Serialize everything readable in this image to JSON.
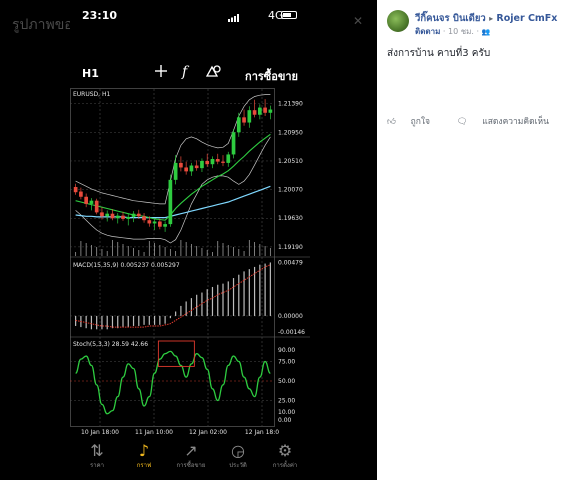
{
  "photo_bg_title": "รูปภาพของ วีกิ๊คนจร บินเดียว",
  "photo_close_glyph": "✕",
  "phone": {
    "status_time": "23:10",
    "status_network": "4G",
    "timeframe": "H1",
    "trade_label": "การซื้อขาย",
    "func_icon": "f"
  },
  "chart_data": {
    "type": "line",
    "symbol_label": "EURUSD, H1",
    "price_ticks": [
      "1.21390",
      "1.20950",
      "1.20510",
      "1.20070",
      "1.19630",
      "1.19190"
    ],
    "price_tick_values": [
      1.2139,
      1.2095,
      1.2051,
      1.2007,
      1.1963,
      1.1919
    ],
    "macd_label": "MACD(15,35,9) 0.005237 0.005297",
    "macd_ticks": [
      "0.00479",
      "0.00000",
      "-0.00146"
    ],
    "stoch_label": "Stoch(5,3,3) 28.59 42.66",
    "stoch_ticks": [
      "90.00",
      "75.00",
      "50.00",
      "25.00",
      "10.00",
      "0.00"
    ],
    "time_labels": [
      "10 Jan 18:00",
      "11 Jan 10:00",
      "12 Jan 02:00",
      "12 Jan 18:0"
    ],
    "candles": [
      [
        1.2011,
        1.2016,
        1.1999,
        1.2003
      ],
      [
        1.2004,
        1.201,
        1.1992,
        1.1996
      ],
      [
        1.1996,
        1.2001,
        1.198,
        1.1985
      ],
      [
        1.1985,
        1.1994,
        1.1975,
        1.199
      ],
      [
        1.199,
        1.1993,
        1.1969,
        1.1972
      ],
      [
        1.1972,
        1.198,
        1.1961,
        1.1966
      ],
      [
        1.1966,
        1.1975,
        1.1958,
        1.197
      ],
      [
        1.197,
        1.1977,
        1.196,
        1.1963
      ],
      [
        1.1963,
        1.1971,
        1.1955,
        1.1967
      ],
      [
        1.1967,
        1.1973,
        1.1959,
        1.1962
      ],
      [
        1.1962,
        1.1969,
        1.1952,
        1.1965
      ],
      [
        1.1965,
        1.1974,
        1.1957,
        1.197
      ],
      [
        1.197,
        1.1976,
        1.1962,
        1.1966
      ],
      [
        1.1966,
        1.1971,
        1.1956,
        1.196
      ],
      [
        1.196,
        1.1966,
        1.195,
        1.1955
      ],
      [
        1.1955,
        1.1963,
        1.1945,
        1.1958
      ],
      [
        1.1958,
        1.1962,
        1.1946,
        1.195
      ],
      [
        1.195,
        1.1958,
        1.1942,
        1.1954
      ],
      [
        1.1954,
        1.203,
        1.195,
        1.2022
      ],
      [
        1.2022,
        1.206,
        1.2015,
        1.2048
      ],
      [
        1.2048,
        1.2058,
        1.2035,
        1.2041
      ],
      [
        1.2041,
        1.205,
        1.203,
        1.2035
      ],
      [
        1.2035,
        1.2048,
        1.2028,
        1.2044
      ],
      [
        1.2044,
        1.2052,
        1.2036,
        1.204
      ],
      [
        1.204,
        1.2055,
        1.2034,
        1.2051
      ],
      [
        1.2051,
        1.2062,
        1.2042,
        1.2046
      ],
      [
        1.2046,
        1.2058,
        1.204,
        1.2054
      ],
      [
        1.2054,
        1.2062,
        1.2046,
        1.205
      ],
      [
        1.205,
        1.206,
        1.2043,
        1.2048
      ],
      [
        1.2048,
        1.2065,
        1.2042,
        1.2061
      ],
      [
        1.2061,
        1.21,
        1.2055,
        1.2095
      ],
      [
        1.2095,
        1.2125,
        1.2088,
        1.2118
      ],
      [
        1.2118,
        1.213,
        1.2105,
        1.211
      ],
      [
        1.211,
        1.2135,
        1.2102,
        1.2129
      ],
      [
        1.2129,
        1.2145,
        1.2118,
        1.2122
      ],
      [
        1.2122,
        1.2138,
        1.2115,
        1.2133
      ],
      [
        1.2133,
        1.2146,
        1.212,
        1.2125
      ],
      [
        1.2125,
        1.2136,
        1.2115,
        1.213
      ]
    ],
    "ma_green": [
      1.199,
      1.1988,
      1.1986,
      1.1984,
      1.1982,
      1.198,
      1.1978,
      1.1976,
      1.1974,
      1.1972,
      1.197,
      1.1968,
      1.1967,
      1.1966,
      1.1964,
      1.1962,
      1.1961,
      1.196,
      1.1968,
      1.1978,
      1.1986,
      1.1993,
      1.2,
      1.2006,
      1.2012,
      1.2017,
      1.2022,
      1.2027,
      1.2031,
      1.2036,
      1.2043,
      1.2051,
      1.2058,
      1.2066,
      1.2073,
      1.208,
      1.2086,
      1.2092
    ],
    "ma_blue": [
      1.1968,
      1.1967,
      1.1966,
      1.1966,
      1.1965,
      1.1965,
      1.1965,
      1.1965,
      1.1965,
      1.1965,
      1.1964,
      1.1964,
      1.1964,
      1.1964,
      1.1964,
      1.1964,
      1.1964,
      1.1964,
      1.1966,
      1.1968,
      1.197,
      1.1972,
      1.1974,
      1.1976,
      1.1978,
      1.198,
      1.1982,
      1.1984,
      1.1986,
      1.1988,
      1.1991,
      1.1994,
      1.1997,
      1.2,
      1.2003,
      1.2006,
      1.2009,
      1.2012
    ],
    "bb_upper": [
      1.202,
      1.2016,
      1.2012,
      1.2008,
      1.2005,
      1.2002,
      1.2,
      1.1998,
      1.1996,
      1.1994,
      1.1992,
      1.199,
      1.1989,
      1.1988,
      1.1987,
      1.1986,
      1.1985,
      1.1985,
      1.202,
      1.2055,
      1.2075,
      1.2085,
      1.2088,
      1.2085,
      1.208,
      1.2076,
      1.2073,
      1.2071,
      1.2072,
      1.2078,
      1.2098,
      1.212,
      1.2135,
      1.2145,
      1.215,
      1.2152,
      1.2153,
      1.2153
    ],
    "bb_lower": [
      1.1975,
      1.1968,
      1.196,
      1.1952,
      1.1945,
      1.194,
      1.1937,
      1.1935,
      1.1934,
      1.1933,
      1.1932,
      1.1931,
      1.1931,
      1.1931,
      1.1932,
      1.1932,
      1.1932,
      1.193,
      1.1925,
      1.193,
      1.1945,
      1.1965,
      1.1985,
      1.2,
      1.2015,
      1.2022,
      1.2026,
      1.2028,
      1.2028,
      1.2026,
      1.202,
      1.2015,
      1.202,
      1.203,
      1.2045,
      1.206,
      1.2075,
      1.2088
    ],
    "macd_hist": [
      -0.0009,
      -0.001,
      -0.0011,
      -0.0012,
      -0.0012,
      -0.0012,
      -0.0012,
      -0.0011,
      -0.0011,
      -0.001,
      -0.001,
      -0.0009,
      -0.0009,
      -0.0008,
      -0.0008,
      -0.0008,
      -0.0008,
      -0.0007,
      -0.0002,
      0.0004,
      0.0009,
      0.0013,
      0.0016,
      0.0019,
      0.0021,
      0.0024,
      0.0026,
      0.0028,
      0.0029,
      0.0031,
      0.0034,
      0.0037,
      0.004,
      0.0042,
      0.0044,
      0.0046,
      0.0047,
      0.0048
    ],
    "macd_signal": [
      -0.0004,
      -0.0005,
      -0.0006,
      -0.0007,
      -0.0008,
      -0.0009,
      -0.0009,
      -0.001,
      -0.001,
      -0.001,
      -0.001,
      -0.001,
      -0.001,
      -0.001,
      -0.0009,
      -0.0009,
      -0.0009,
      -0.0008,
      -0.0007,
      -0.0004,
      -0.0001,
      0.0002,
      0.0005,
      0.0008,
      0.0011,
      0.0014,
      0.0016,
      0.0019,
      0.0021,
      0.0023,
      0.0026,
      0.0029,
      0.0032,
      0.0035,
      0.0038,
      0.0041,
      0.0044,
      0.0046
    ],
    "stoch": [
      60,
      78,
      82,
      70,
      45,
      20,
      8,
      12,
      30,
      55,
      72,
      66,
      40,
      18,
      30,
      60,
      78,
      85,
      88,
      82,
      70,
      55,
      72,
      85,
      80,
      65,
      40,
      25,
      45,
      70,
      82,
      75,
      55,
      40,
      30,
      55,
      75,
      60
    ],
    "colors": {
      "bull": "#2ecc40",
      "bear": "#e84a3c",
      "ma_green": "#2ecc40",
      "ma_blue": "#7fd8ff",
      "bands": "#c8c8c8",
      "signal": "#e23b2e",
      "highlight": "#e23b2e"
    }
  },
  "nav": [
    {
      "label": "ราคา",
      "icon": "⇅"
    },
    {
      "label": "กราฟ",
      "icon": "♪"
    },
    {
      "label": "การซื้อขาย",
      "icon": "↗"
    },
    {
      "label": "ประวัติ",
      "icon": "◶"
    },
    {
      "label": "การตั้งค่า",
      "icon": "⚙"
    }
  ],
  "fb": {
    "author": "วีกิ๊คนจร บินเดียว",
    "arrow": "▸",
    "target": "Rojer CmFx",
    "follow": "ติดตาม",
    "time": "10 ชม.",
    "privacy_icon": "👥",
    "text": "ส่งการบ้าน คาบที่3 ครับ",
    "like": "ถูกใจ",
    "comment": "แสดงความคิดเห็น"
  }
}
